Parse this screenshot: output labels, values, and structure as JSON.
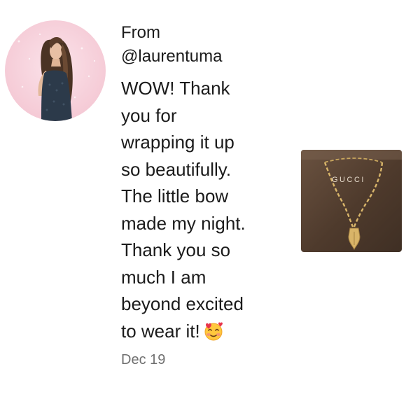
{
  "message": {
    "from_label": "From",
    "handle": "@laurentuma",
    "lines": [
      "WOW! Thank",
      "you for",
      "wrapping it up",
      "so beautifully.",
      "The little bow",
      "made my night.",
      "Thank you so",
      "much I am",
      "beyond excited",
      "to wear it!"
    ],
    "emoji": "smiling-face-with-hearts",
    "date": "Dec 19"
  },
  "product_image": {
    "brand_text": "GUCCI"
  },
  "colors": {
    "text": "#1b1b1b",
    "date": "#6f6f6f",
    "avatar_bg": "#f7d3dc",
    "product_bg": "#5b4434"
  }
}
